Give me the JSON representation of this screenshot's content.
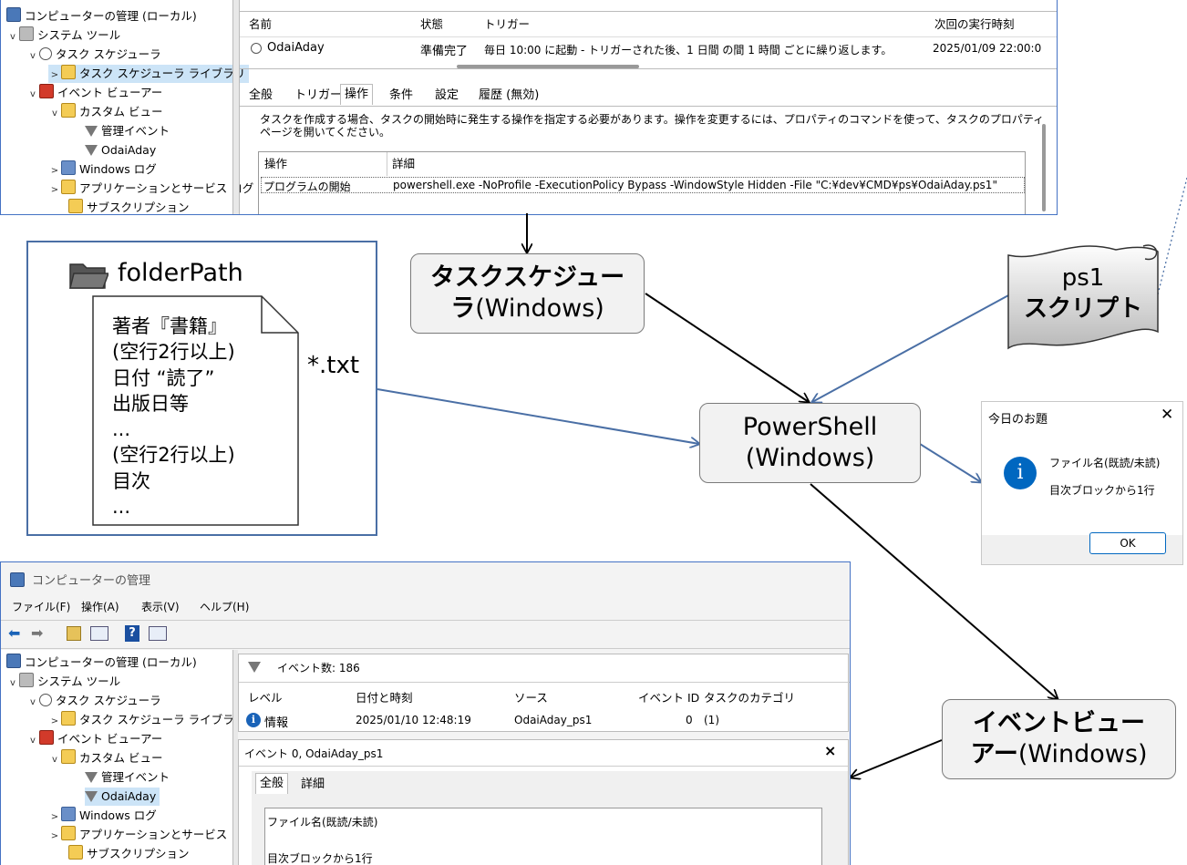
{
  "top_window": {
    "tree": [
      {
        "label": "コンピューターの管理 (ローカル)",
        "icon": "computer-icon"
      },
      {
        "label": "システム ツール",
        "icon": "tools-icon"
      },
      {
        "label": "タスク スケジューラ",
        "icon": "clock-icon"
      },
      {
        "label": "タスク スケジューラ ライブラリ",
        "icon": "folder-clock-icon"
      },
      {
        "label": "イベント ビューアー",
        "icon": "event-viewer-icon"
      },
      {
        "label": "カスタム ビュー",
        "icon": "folder-icon"
      },
      {
        "label": "管理イベント",
        "icon": "filter-icon"
      },
      {
        "label": "OdaiAday",
        "icon": "filter-icon"
      },
      {
        "label": "Windows ログ",
        "icon": "windows-log-icon"
      },
      {
        "label": "アプリケーションとサービス ログ",
        "icon": "folder-icon"
      },
      {
        "label": "サブスクリプション",
        "icon": "subscription-icon"
      }
    ],
    "columns": [
      "名前",
      "状態",
      "トリガー",
      "次回の実行時刻"
    ],
    "task_row": {
      "name": "OdaiAday",
      "status": "準備完了",
      "trigger": "毎日 10:00 に起動 - トリガーされた後、1 日間 の間 1 時間 ごとに繰り返します。",
      "next_run": "2025/01/09 22:00:0"
    },
    "tabs": [
      "全般",
      "トリガー",
      "操作",
      "条件",
      "設定",
      "履歴 (無効)"
    ],
    "instruction_line1": "タスクを作成する場合、タスクの開始時に発生する操作を指定する必要があります。操作を変更するには、プロパティのコマンドを使って、タスクのプロパティ",
    "instruction_line2": "ページを開いてください。",
    "action_columns": [
      "操作",
      "詳細"
    ],
    "action_row": {
      "action": "プログラムの開始",
      "detail": "powershell.exe -NoProfile  -ExecutionPolicy Bypass -WindowStyle Hidden  -File \"C:¥dev¥CMD¥ps¥OdaiAday.ps1\""
    }
  },
  "folder_panel": {
    "title": "folderPath",
    "file_lines": [
      "著者『書籍』",
      "(空行2行以上)",
      "日付  “読了”",
      "出版日等",
      "...",
      "(空行2行以上)",
      "目次",
      "..."
    ],
    "ext_label": "*.txt"
  },
  "nodes": {
    "task_scheduler": {
      "bold": "タスクスケジュー",
      "bold2": "ラ",
      "normal": "(Windows)"
    },
    "ps1_script": {
      "line1": "ps1",
      "line2": "スクリプト"
    },
    "powershell": {
      "line1": "PowerShell",
      "line2": "(Windows)"
    },
    "event_viewer": {
      "bold": "イベントビュー",
      "bold2": "アー",
      "normal": "(Windows)"
    }
  },
  "dialog": {
    "title": "今日のお題",
    "close": "✕",
    "line1": "ファイル名(既読/未読)",
    "line2": "目次ブロックから1行",
    "ok": "OK",
    "info_glyph": "i"
  },
  "bottom_window": {
    "title": "コンピューターの管理",
    "menu": [
      "ファイル(F)",
      "操作(A)",
      "表示(V)",
      "ヘルプ(H)"
    ],
    "tree": [
      {
        "label": "コンピューターの管理 (ローカル)",
        "icon": "computer-icon"
      },
      {
        "label": "システム ツール",
        "icon": "tools-icon"
      },
      {
        "label": "タスク スケジューラ",
        "icon": "clock-icon"
      },
      {
        "label": "タスク スケジューラ ライブラリ",
        "icon": "folder-clock-icon"
      },
      {
        "label": "イベント ビューアー",
        "icon": "event-viewer-icon"
      },
      {
        "label": "カスタム ビュー",
        "icon": "folder-icon"
      },
      {
        "label": "管理イベント",
        "icon": "filter-icon"
      },
      {
        "label": "OdaiAday",
        "icon": "filter-icon"
      },
      {
        "label": "Windows ログ",
        "icon": "windows-log-icon"
      },
      {
        "label": "アプリケーションとサービス ログ",
        "icon": "folder-icon"
      },
      {
        "label": "サブスクリプション",
        "icon": "subscription-icon"
      }
    ],
    "event_count": "イベント数: 186",
    "columns": [
      "レベル",
      "日付と時刻",
      "ソース",
      "イベント ID",
      "タスクのカテゴリ"
    ],
    "event_row": {
      "level": "情報",
      "datetime": "2025/01/10 12:48:19",
      "source": "OdaiAday_ps1",
      "id": "0",
      "category": "(1)"
    },
    "detail_title": "イベント 0, OdaiAday_ps1",
    "detail_close": "×",
    "detail_tabs": [
      "全般",
      "詳細"
    ],
    "detail_line1": "ファイル名(既読/未読)",
    "detail_line2": "目次ブロックから1行"
  },
  "colors": {
    "accent_blue": "#4a6fa5",
    "panel_border": "#4472c4",
    "node_fill": "#f2f2f2",
    "info_blue": "#0067c0"
  }
}
